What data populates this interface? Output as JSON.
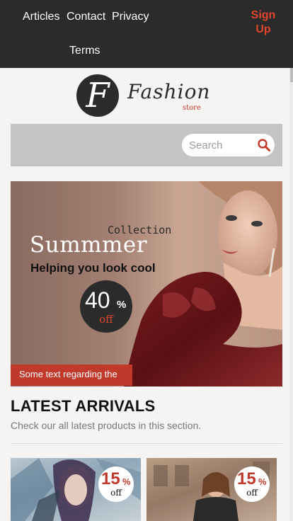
{
  "nav": {
    "links": [
      "Articles",
      "Contact",
      "Privacy",
      "Terms"
    ],
    "signup_line1": "Sign",
    "signup_line2": "Up"
  },
  "logo": {
    "letter": "F",
    "word": "Fashion",
    "sub": "store"
  },
  "search": {
    "placeholder": "Search"
  },
  "hero": {
    "collection": "Collection",
    "title": "Summmer",
    "tagline": "Helping you look cool",
    "discount_value": "40",
    "discount_unit": "%",
    "discount_off": "off",
    "strip_text": "Some text regarding the"
  },
  "latest": {
    "title": "LATEST ARRIVALS",
    "subtitle": "Check our all latest products in this section.",
    "products": [
      {
        "discount_value": "15",
        "discount_unit": "%",
        "discount_off": "off"
      },
      {
        "discount_value": "15",
        "discount_unit": "%",
        "discount_off": "off"
      }
    ]
  },
  "colors": {
    "nav_bg": "#2b2b2b",
    "accent": "#e0452e",
    "brand_red": "#c0392b",
    "search_band": "#c4c4c4",
    "page_bg": "#f5f4f2"
  }
}
